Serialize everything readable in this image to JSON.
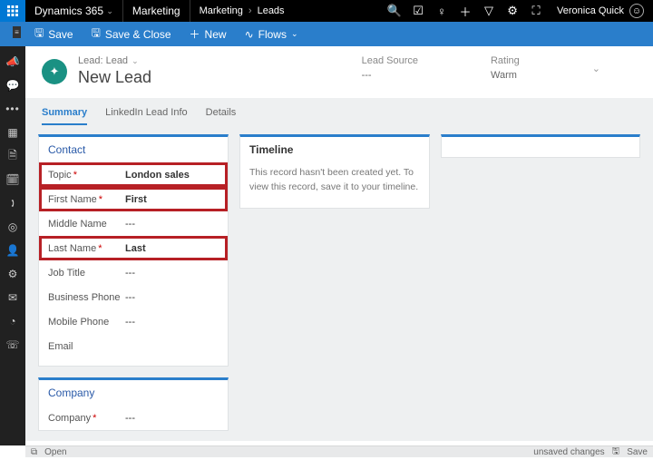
{
  "app": {
    "name": "Dynamics 365",
    "area": "Marketing",
    "breadcrumb": [
      "Marketing",
      "Leads"
    ],
    "user": "Veronica Quick"
  },
  "commands": {
    "save": "Save",
    "save_close": "Save & Close",
    "new": "New",
    "flows": "Flows"
  },
  "record": {
    "entity_label": "Lead: Lead",
    "title": "New Lead",
    "lead_source": {
      "label": "Lead Source",
      "value": "---"
    },
    "rating": {
      "label": "Rating",
      "value": "Warm"
    }
  },
  "tabs": {
    "summary": "Summary",
    "linkedin": "LinkedIn Lead Info",
    "details": "Details"
  },
  "contact_card": {
    "title": "Contact",
    "fields": {
      "topic": {
        "label": "Topic",
        "value": "London sales",
        "required": true,
        "highlight": true
      },
      "first_name": {
        "label": "First Name",
        "value": "First",
        "required": true,
        "highlight": true
      },
      "middle_name": {
        "label": "Middle Name",
        "value": "---",
        "required": false,
        "highlight": false
      },
      "last_name": {
        "label": "Last Name",
        "value": "Last",
        "required": true,
        "highlight": true
      },
      "job_title": {
        "label": "Job Title",
        "value": "---",
        "required": false,
        "highlight": false
      },
      "business_phone": {
        "label": "Business Phone",
        "value": "---",
        "required": false,
        "highlight": false
      },
      "mobile_phone": {
        "label": "Mobile Phone",
        "value": "---",
        "required": false,
        "highlight": false
      },
      "email": {
        "label": "Email",
        "value": "",
        "required": false,
        "highlight": false
      }
    }
  },
  "company_card": {
    "title": "Company",
    "fields": {
      "company": {
        "label": "Company",
        "value": "---",
        "required": true
      }
    }
  },
  "timeline_card": {
    "title": "Timeline",
    "message": "This record hasn't been created yet.  To view this record, save it to your timeline."
  },
  "status": {
    "open": "Open",
    "unsaved": "unsaved changes",
    "save": "Save"
  }
}
